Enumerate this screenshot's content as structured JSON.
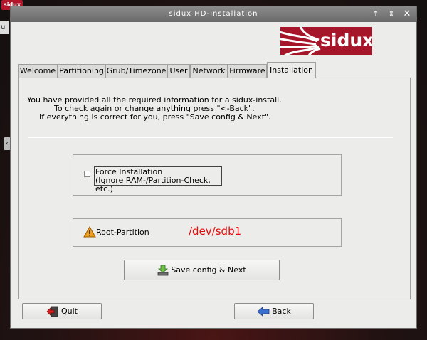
{
  "desktop": {
    "logo_text": "sidux",
    "strip_text": "u"
  },
  "window": {
    "title": "sidux HD-Installation",
    "controls": {
      "up": "↑",
      "restore": "⇕",
      "close": "✕"
    }
  },
  "brand": {
    "logo_text": "sidux"
  },
  "tabs": [
    {
      "label": "Welcome"
    },
    {
      "label": "Partitioning"
    },
    {
      "label": "Grub/Timezone"
    },
    {
      "label": "User"
    },
    {
      "label": "Network"
    },
    {
      "label": "Firmware"
    },
    {
      "label": "Installation",
      "active": true
    }
  ],
  "message": {
    "line1": "You have provided all the required information for a sidux-install.",
    "line2": "To check again or change anything press \"<-Back\".",
    "line3": "If everything is correct for you, press \"Save config & Next\"."
  },
  "force": {
    "checked": false,
    "line1": "Force Installation",
    "line2": "(Ignore RAM-/Partition-Check, etc.)"
  },
  "root": {
    "label": "Root-Partition",
    "value": "/dev/sdb1",
    "warning_icon": "warning-icon"
  },
  "buttons": {
    "save_next": "Save config & Next",
    "quit": "Quit",
    "back": "Back"
  },
  "colors": {
    "brand": "#a5162a",
    "root_value": "#e40b0b",
    "titlebar": "#7a7a7a"
  }
}
